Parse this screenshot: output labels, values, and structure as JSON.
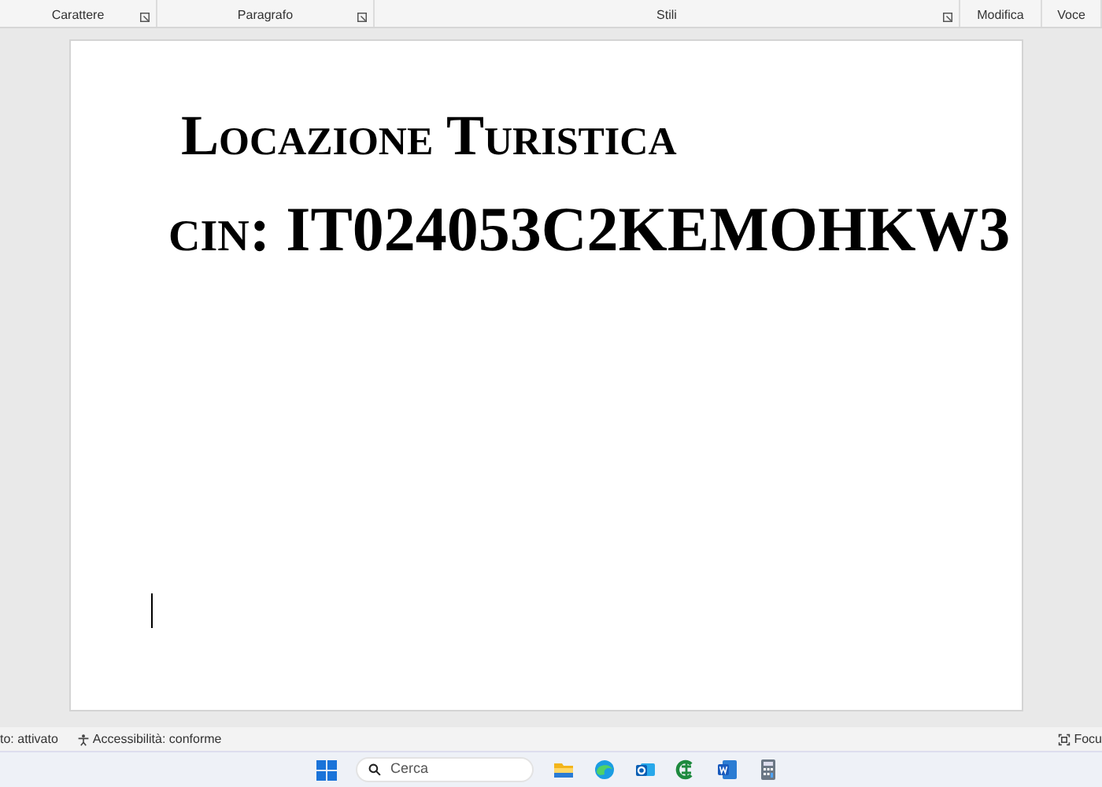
{
  "ribbon": {
    "groups": [
      {
        "label": "Carattere"
      },
      {
        "label": "Paragrafo"
      },
      {
        "label": "Stili"
      },
      {
        "label": "Modifica"
      },
      {
        "label": "Voce"
      }
    ]
  },
  "document": {
    "lines": [
      {
        "text": "Locazione Turistica"
      },
      {
        "text": "cin: IT024053C2KEMOHKW3"
      }
    ]
  },
  "status_bar": {
    "left": [
      "to: attivato",
      "Accessibilità: conforme"
    ],
    "right": "Focu"
  },
  "taskbar": {
    "search": {
      "placeholder": "Cerca"
    }
  }
}
